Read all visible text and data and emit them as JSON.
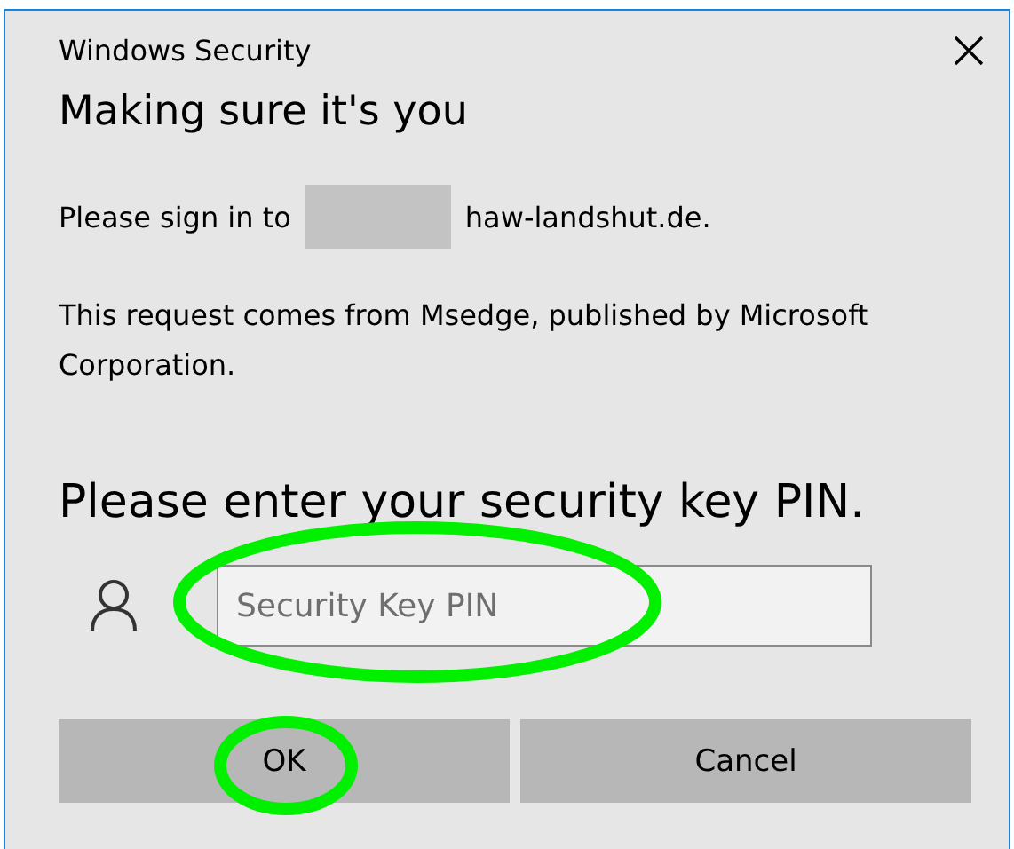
{
  "window": {
    "title": "Windows Security"
  },
  "heading": "Making sure it's you",
  "sign_in": {
    "before": "Please sign in to",
    "after": "haw-landshut.de."
  },
  "request_note": "This request comes from Msedge, published by Microsoft Corporation.",
  "prompt": "Please enter your security key PIN.",
  "pin_field": {
    "placeholder": "Security Key PIN"
  },
  "buttons": [
    {
      "label": "OK"
    },
    {
      "label": "Cancel"
    }
  ]
}
